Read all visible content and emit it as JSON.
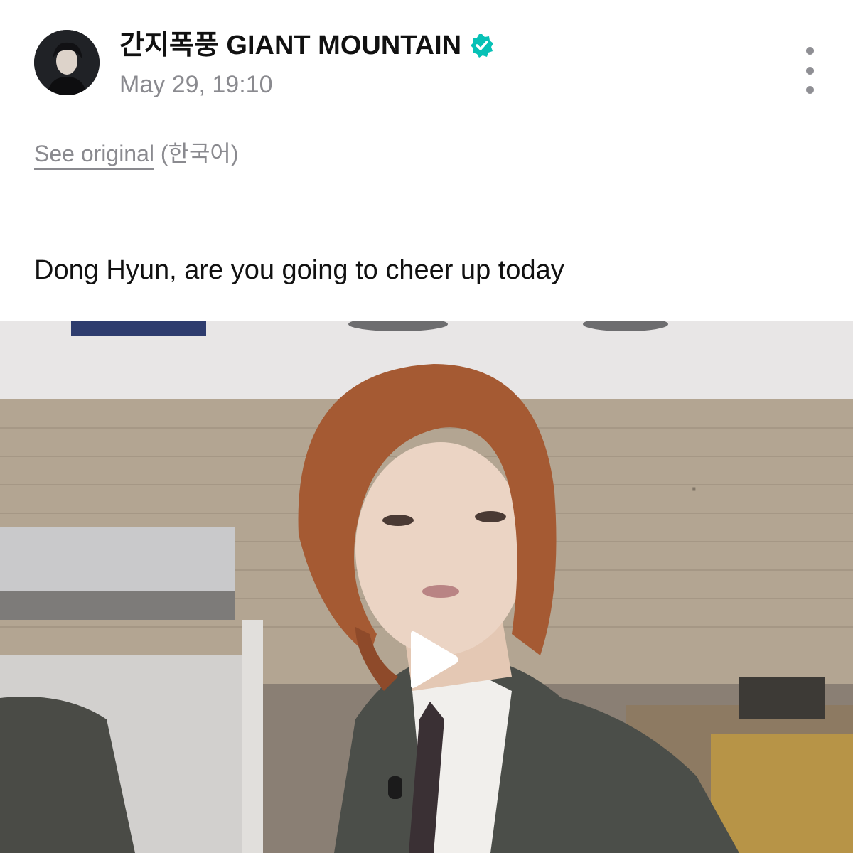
{
  "post": {
    "author_name": "간지폭풍 GIANT MOUNTAIN",
    "timestamp": "May 29, 19:10",
    "see_original_label": "See original",
    "original_language": "(한국어)",
    "body_text": "Dong Hyun, are you going to cheer up today"
  },
  "icons": {
    "verified": "verified-badge-icon",
    "more": "more-vertical-icon",
    "play": "play-icon"
  },
  "colors": {
    "verified_badge": "#07c1b6",
    "muted_text": "#8a8a8f",
    "primary_text": "#111111"
  }
}
